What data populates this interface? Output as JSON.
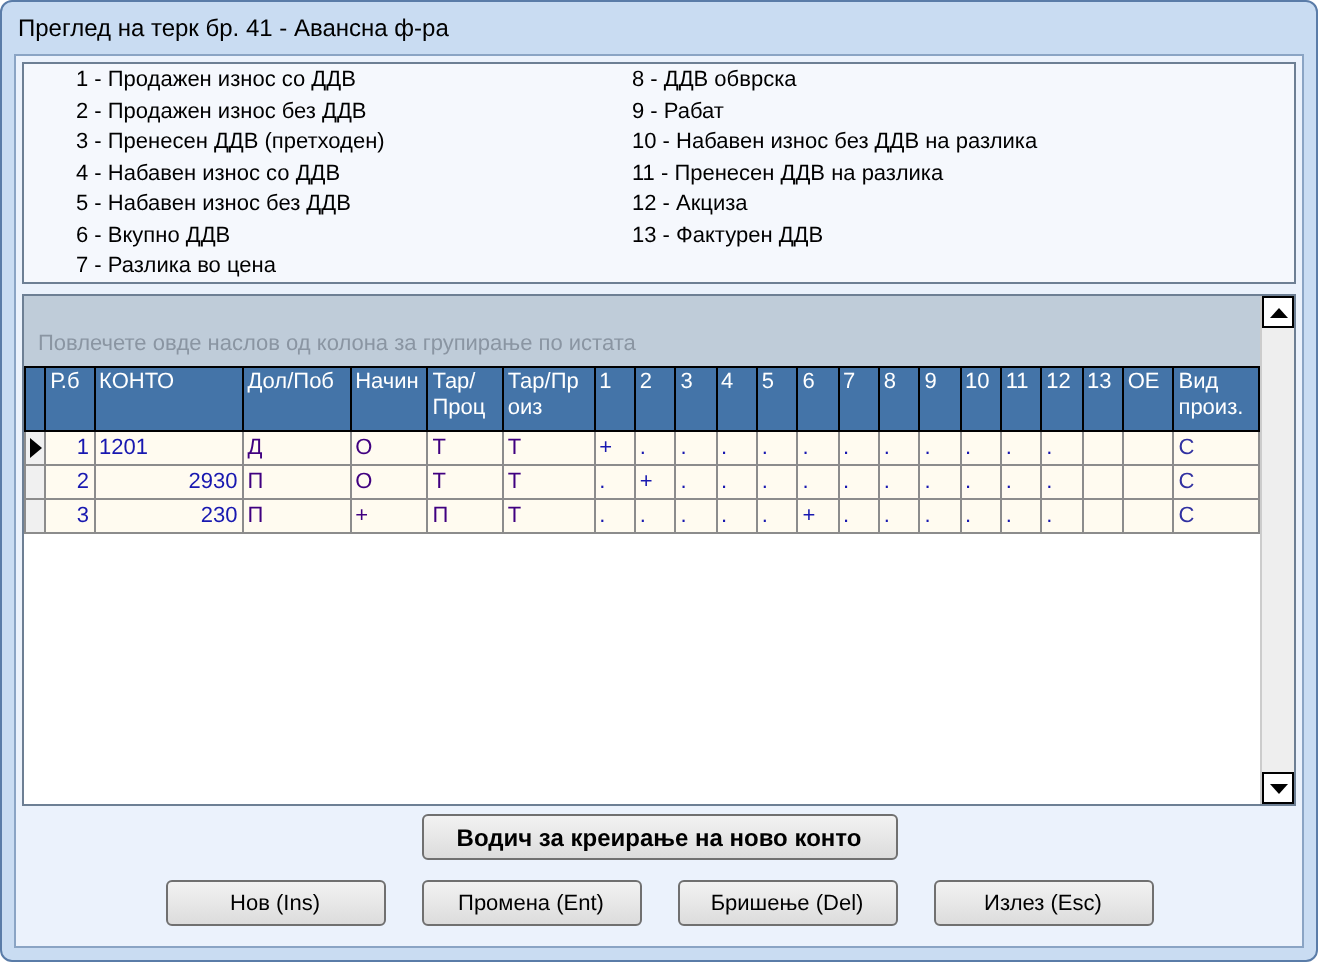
{
  "window": {
    "title": "Преглед на терк бр. 41 - Авансна ф-ра"
  },
  "legend": {
    "column_1": [
      "1 - Продажен износ со ДДВ",
      "2 - Продажен износ без ДДВ",
      "3 - Пренесен ДДВ (претходен)",
      "4 - Набавен износ со ДДВ",
      "5 - Набавен износ без ДДВ",
      "6 - Вкупно ДДВ",
      "7 - Разлика во цена"
    ],
    "column_2": [
      "8 - ДДВ обврска",
      "9 - Рабат",
      "10 - Набавен износ без ДДВ на разлика",
      "11 - Пренесен ДДВ на разлика",
      "12 - Акциза",
      "13 - Фактурен ДДВ"
    ]
  },
  "grid": {
    "group_hint": "Повлечете овде наслов од колона за групирање по истата",
    "columns": [
      "Р.б",
      "КОНТО",
      "Дол/Поб",
      "Начин",
      "Тар/ Проц",
      "Тар/Пр оиз",
      "1",
      "2",
      "3",
      "4",
      "5",
      "6",
      "7",
      "8",
      "9",
      "10",
      "11",
      "12",
      "13",
      "ОЕ",
      "Вид произ."
    ],
    "rows": [
      {
        "selected": true,
        "cells": [
          "1",
          "1201",
          "Д",
          "О",
          "Т",
          "Т",
          "+",
          ".",
          ".",
          ".",
          ".",
          ".",
          ".",
          ".",
          ".",
          ".",
          ".",
          ".",
          "",
          "",
          "С"
        ]
      },
      {
        "selected": false,
        "cells": [
          "2",
          "2930",
          "П",
          "О",
          "Т",
          "Т",
          ".",
          "+",
          ".",
          ".",
          ".",
          ".",
          ".",
          ".",
          ".",
          ".",
          ".",
          ".",
          "",
          "",
          "С"
        ]
      },
      {
        "selected": false,
        "cells": [
          "3",
          "230",
          "П",
          "+",
          "П",
          "Т",
          ".",
          ".",
          ".",
          ".",
          ".",
          "+",
          ".",
          ".",
          ".",
          ".",
          ".",
          ".",
          "",
          "",
          "С"
        ]
      }
    ]
  },
  "wizard_button": "Водич за креирање на ново конто",
  "buttons": [
    "Нов (Ins)",
    "Промена (Ent)",
    "Бришење (Del)",
    "Излез (Esc)"
  ]
}
